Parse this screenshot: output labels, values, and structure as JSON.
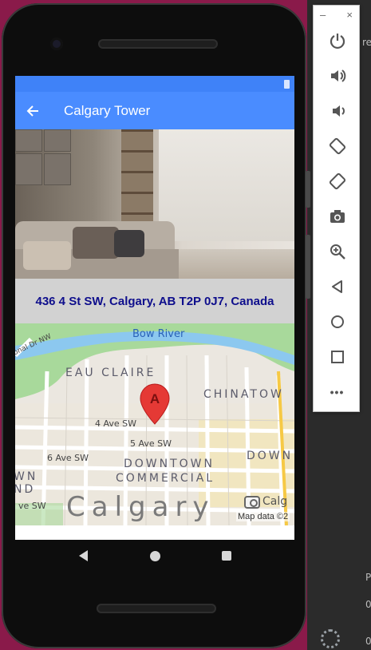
{
  "app": {
    "title": "Calgary Tower",
    "address": "436 4 St SW, Calgary, AB T2P 0J7, Canada"
  },
  "map": {
    "labels": {
      "river": "Bow River",
      "street_nw": "onal Dr NW",
      "district_1": "EAU CLAIRE",
      "district_2": "CHINATOW",
      "street_4ave": "4 Ave SW",
      "street_5ave": "5 Ave SW",
      "street_6ave": "6 Ave SW",
      "downtown_1": "DOWNTOWN",
      "downtown_2": "COMMERCIAL",
      "downtown_right": "DOWN",
      "left_frag_1": "WN",
      "left_frag_2": "ND",
      "left_frag_3": "ve SW",
      "city": "Calgary",
      "city_frag": "Calg"
    },
    "marker_letter": "A",
    "attribution": "Map data ©2"
  },
  "emulator_toolbar": {
    "minimize": "–",
    "close": "×",
    "tools": [
      "power-icon",
      "volume-up-icon",
      "volume-down-icon",
      "rotate-left-icon",
      "rotate-right-icon",
      "screenshot-icon",
      "zoom-icon",
      "back-icon",
      "home-icon",
      "overview-icon",
      "more-icon"
    ],
    "more_label": "•••"
  },
  "ide": {
    "fragment_top": "re",
    "fragment_p": "P",
    "fragment_0a": "0",
    "fragment_0b": "0"
  },
  "colors": {
    "app_bar": "#4a8cff",
    "address_text": "#0e0e8c",
    "marker": "#e53935"
  }
}
